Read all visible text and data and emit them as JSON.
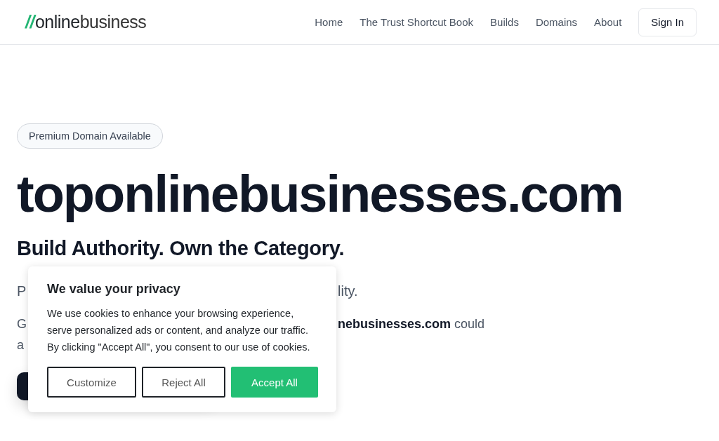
{
  "header": {
    "logo": {
      "mark": "//",
      "bold": "online",
      "light": "business"
    },
    "nav": [
      {
        "label": "Home"
      },
      {
        "label": "The Trust Shortcut Book"
      },
      {
        "label": "Builds"
      },
      {
        "label": "Domains"
      },
      {
        "label": "About"
      }
    ],
    "sign_in": "Sign In"
  },
  "hero": {
    "badge": "Premium Domain Available",
    "title": "toponlinebusinesses.com",
    "subtitle": "Build Authority. Own the Category.",
    "paragraph_1_visible": [
      "P",
      "lity."
    ],
    "paragraph_2_visible": [
      [
        "G",
        "**nebusinesses.com** could"
      ],
      [
        "a"
      ]
    ]
  },
  "cookie_banner": {
    "title": "We value your privacy",
    "text": "We use cookies to enhance your browsing experience, serve personalized ads or content, and analyze our traffic. By clicking \"Accept All\", you consent to our use of cookies.",
    "buttons": [
      {
        "label": "Customize",
        "kind": "outline"
      },
      {
        "label": "Reject All",
        "kind": "outline"
      },
      {
        "label": "Accept All",
        "kind": "primary"
      }
    ]
  }
}
